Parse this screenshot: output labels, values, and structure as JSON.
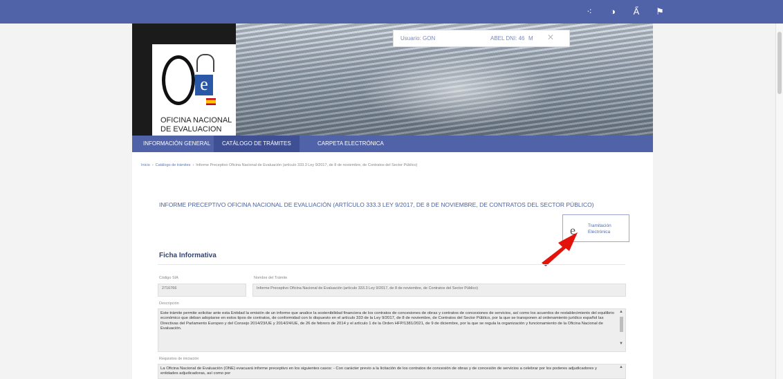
{
  "toolbar": {
    "icons": [
      "accessibility-icon",
      "contrast-icon",
      "text-size-icon",
      "flag-icon"
    ],
    "glyphs": [
      "⁖",
      "◑",
      "A̋",
      "⚑"
    ]
  },
  "banner": {
    "logo_line1": "OFICINA NACIONAL",
    "logo_line2": "DE EVALUACION",
    "logo_letter": "e"
  },
  "user": {
    "user_label": "Usuario: GON",
    "name": "ABEL DNI: 46",
    "initial": "M",
    "close": "✕"
  },
  "nav": {
    "items": [
      "INFORMACIÓN GENERAL",
      "CATÁLOGO DE TRÁMITES",
      "CARPETA ELECTRÓNICA"
    ]
  },
  "breadcrumb": {
    "home": "Inicio",
    "catalog": "Catálogo de trámites",
    "current": "Informe Preceptivo Oficina Nacional de Evaluación (artículo 333.3 Ley 9/2017, de 8 de noviembre, de Contratos del Sector Público)"
  },
  "main": {
    "title": "INFORME PRECEPTIVO OFICINA NACIONAL DE EVALUACIÓN (ARTÍCULO 333.3 LEY 9/2017, DE 8 DE NOVIEMBRE, DE CONTRATOS DEL SECTOR PÚBLICO)",
    "tramitacion_line1": "Tramitación",
    "tramitacion_line2": "Electrónica",
    "tramitacion_glyph": "e",
    "section_title": "Ficha Informativa"
  },
  "form": {
    "codigo_label": "Código SIA",
    "codigo_value": "2716766",
    "nombre_label": "Nombre del Trámite",
    "nombre_value": "Informe Preceptivo Oficina Nacional de Evaluación (artículo 333.3 Ley 9/2017, de 8 de noviembre, de Contratos del Sector Público)",
    "descripcion_label": "Descripción",
    "descripcion_value": "Este trámite permite solicitar ante esta Entidad la emisión de un informe que analice la sostenibilidad financiera de los contratos de concesiones de obras y contratos de concesiones de servicios, así como los acuerdos de restablecimiento del equilibrio económico que deban adoptarse en estos tipos de contratos, de conformidad con lo dispuesto en el artículo 333 de la Ley 9/2017, de 8 de noviembre, de Contratos del Sector Público, por la que se transponen al ordenamiento jurídico español las Directivas del Parlamento Europeo y del Consejo 2014/23/UE y 2014/24/UE, de 26 de febrero de 2014 y el artículo 1 de la Orden HFP/1381/2021, de 9 de diciembre, por la que se regula la organización y funcionamiento de la Oficina Nacional de Evaluación.",
    "requisitos_label": "Requisitos de iniciación",
    "requisitos_value": "La Oficina Nacional de Evaluación (ONE) evacuará informe preceptivo en los siguientes casos: - Con carácter previo a la licitación de los contratos de concesión de obras y de concesión de servicios a celebrar por los poderes adjudicadores y entidades adjudicadoras, así como por"
  }
}
